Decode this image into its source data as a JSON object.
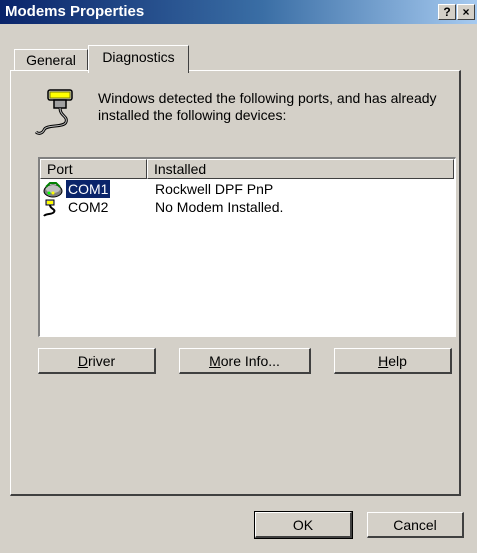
{
  "window": {
    "title": "Modems Properties"
  },
  "title_buttons": {
    "help": "?",
    "close": "×"
  },
  "tabs": [
    {
      "label": "General",
      "active": false
    },
    {
      "label": "Diagnostics",
      "active": true
    }
  ],
  "description": "Windows detected the following ports, and has already installed the following devices:",
  "icons": {
    "header": "serial-port-cable-icon",
    "modem": "modem-icon",
    "port": "serial-port-icon"
  },
  "list": {
    "columns": [
      "Port",
      "Installed"
    ],
    "rows": [
      {
        "port": "COM1",
        "installed": "Rockwell DPF PnP",
        "selected": true,
        "icon": "modem-icon"
      },
      {
        "port": "COM2",
        "installed": "No Modem Installed.",
        "selected": false,
        "icon": "serial-port-icon"
      }
    ]
  },
  "panel_buttons": {
    "driver": {
      "mnemonic": "D",
      "rest": "river"
    },
    "more_info": {
      "mnemonic": "M",
      "rest": "ore Info..."
    },
    "help": {
      "mnemonic": "H",
      "rest": "elp"
    }
  },
  "dialog_buttons": {
    "ok": "OK",
    "cancel": "Cancel"
  },
  "colors": {
    "face": "#d4d0c8",
    "title_start": "#0a246a",
    "title_end": "#a6caf0",
    "selection": "#0a246a"
  }
}
